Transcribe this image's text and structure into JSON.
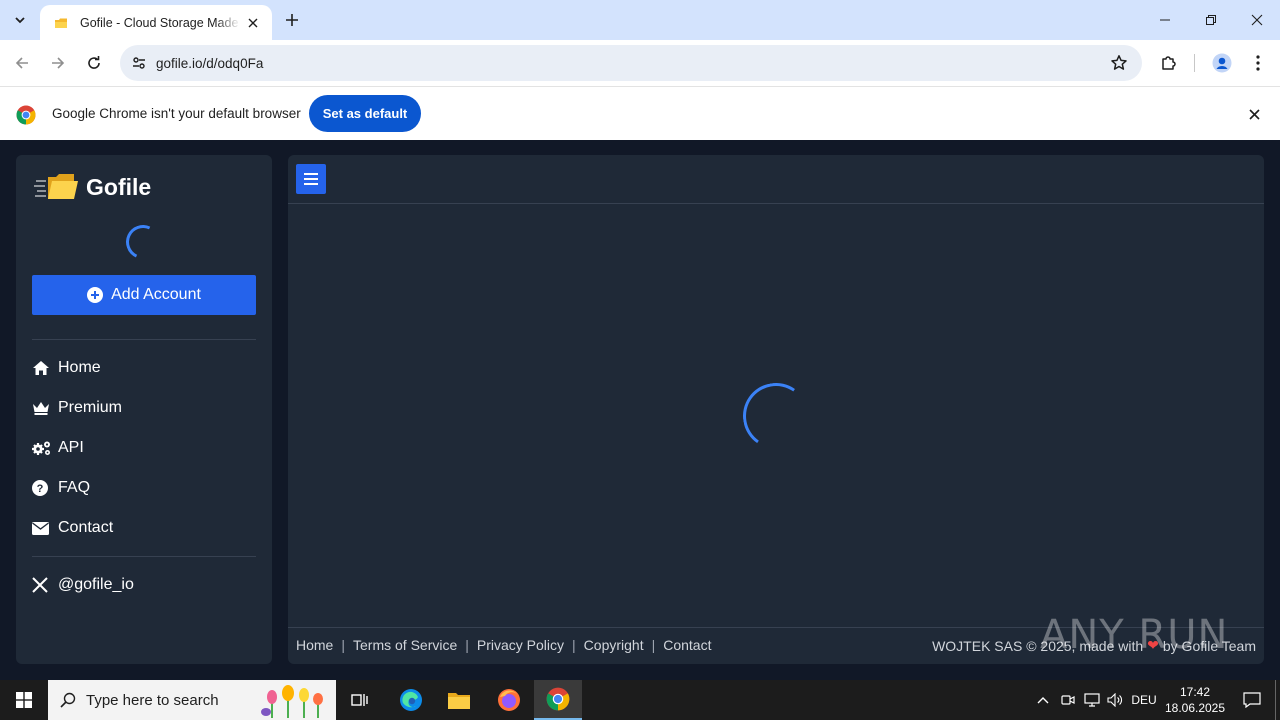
{
  "browser": {
    "tab": {
      "title": "Gofile - Cloud Storage Made Simple"
    },
    "url": "gofile.io/d/odq0Fa"
  },
  "infobar": {
    "message": "Google Chrome isn't your default browser",
    "button": "Set as default"
  },
  "sidebar": {
    "logo": "Gofile",
    "add_account": "Add Account",
    "nav": [
      {
        "label": "Home",
        "icon": "home-icon"
      },
      {
        "label": "Premium",
        "icon": "crown-icon"
      },
      {
        "label": "API",
        "icon": "cogs-icon"
      },
      {
        "label": "FAQ",
        "icon": "question-icon"
      },
      {
        "label": "Contact",
        "icon": "envelope-icon"
      }
    ],
    "social": {
      "label": "@gofile_io",
      "icon": "x-logo-icon"
    }
  },
  "footer": {
    "links": [
      "Home",
      "Terms of Service",
      "Privacy Policy",
      "Copyright",
      "Contact"
    ],
    "credit_prefix": "WOJTEK SAS © 2025, made with",
    "credit_suffix": "by Gofile Team"
  },
  "watermark": "ANY RUN",
  "taskbar": {
    "search_placeholder": "Type here to search",
    "language": "DEU",
    "time": "17:42",
    "date": "18.06.2025"
  },
  "colors": {
    "accent": "#2563eb",
    "page_bg": "#111827",
    "panel_bg": "#1f2937",
    "chrome_tabstrip": "#d3e3fd",
    "chrome_button": "#0b57d0"
  }
}
